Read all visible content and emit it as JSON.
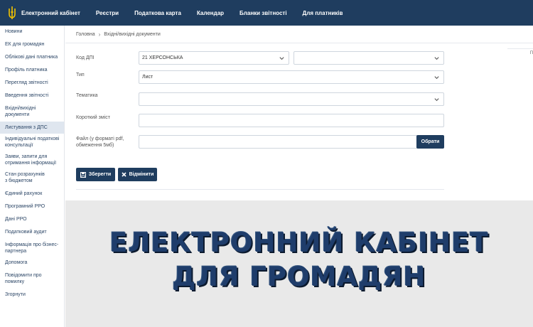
{
  "header": {
    "brand": "Електронний кабінет",
    "nav": [
      "Реєстри",
      "Податкова карта",
      "Календар",
      "Бланки звітності",
      "Для платників"
    ]
  },
  "sidebar": {
    "items": [
      {
        "label": "Новини",
        "active": false
      },
      {
        "label": "ЕК для громадян",
        "active": false
      },
      {
        "label": "Облікові дані платника",
        "active": false
      },
      {
        "label": "Профіль платника",
        "active": false
      },
      {
        "label": "Перегляд звітності",
        "active": false
      },
      {
        "label": "Введення звітності",
        "active": false
      },
      {
        "label": "Вхідні/вихідні документи",
        "active": false
      },
      {
        "label": "Листування з ДПС",
        "active": true
      },
      {
        "label": "Індивідуальні податкові консультації",
        "active": false
      },
      {
        "label": "Заяви, запити для отримання інформації",
        "active": false
      },
      {
        "label": "Стан розрахунків з бюджетом",
        "active": false
      },
      {
        "label": "Єдиний рахунок",
        "active": false
      },
      {
        "label": "Програмний РРО",
        "active": false
      },
      {
        "label": "Дані РРО",
        "active": false
      },
      {
        "label": "Податковий аудит",
        "active": false
      },
      {
        "label": "Інформація про бізнес-партнера",
        "active": false
      },
      {
        "label": "Допомога",
        "active": false
      },
      {
        "label": "Повідомити про помилку",
        "active": false
      },
      {
        "label": "Згорнути",
        "active": false
      }
    ]
  },
  "breadcrumb": {
    "home": "Головна",
    "current": "Вхідні/вихідні документи"
  },
  "form": {
    "dps_label": "Код ДПІ",
    "dps_value": "21 ХЕРСОНСЬКА",
    "dps_second_value": "",
    "type_label": "Тип",
    "type_value": "Лист",
    "topic_label": "Тематика",
    "topic_value": "",
    "summary_label": "Короткий зміст",
    "summary_value": "",
    "file_label": "Файл (у форматі pdf, обмеження 5мб)",
    "file_value": "",
    "pick_button": "Обрати",
    "save_button": "Зберегти",
    "cancel_button": "Відмінити",
    "edge_text": "П"
  },
  "banner": {
    "line1": "ЕЛЕКТРОННИЙ КАБІНЕТ",
    "line2": "ДЛЯ ГРОМАДЯН"
  },
  "colors": {
    "primary": "#1f3d5f",
    "banner_bg": "#e9e9e9",
    "logo_gold": "#f2c200"
  }
}
